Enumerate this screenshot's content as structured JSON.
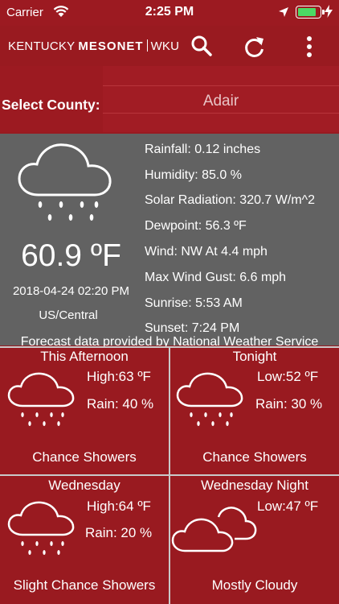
{
  "status_bar": {
    "carrier": "Carrier",
    "time": "2:25 PM",
    "icons": [
      "wifi-icon",
      "location-arrow-icon",
      "battery-icon",
      "charging-icon"
    ],
    "battery_color": "#4cd964"
  },
  "app_bar": {
    "logo_prefix": "KENTUCKY ",
    "logo_bold": "MESONET",
    "logo_suffix": "WKU",
    "actions": [
      "search-icon",
      "refresh-icon",
      "more-vertical-icon"
    ]
  },
  "county": {
    "label": "Select County:",
    "selected": "Adair"
  },
  "current": {
    "icon": "rain-cloud-icon",
    "temperature": "60.9 ºF",
    "datetime": "2018-04-24 02:20 PM",
    "timezone": "US/Central",
    "stats": [
      "Rainfall: 0.12 inches",
      "Humidity: 85.0 %",
      "Solar Radiation: 320.7 W/m^2",
      "Dewpoint: 56.3 ºF",
      "Wind: NW At 4.4 mph",
      "Max Wind Gust: 6.6 mph",
      "Sunrise: 5:53 AM",
      "Sunset: 7:24 PM"
    ]
  },
  "forecast_credit": "Forecast data provided by National Weather Service",
  "forecast": [
    {
      "period": "This Afternoon",
      "temp": "High:63 ºF",
      "rain": "Rain: 40 %",
      "summary": "Chance Showers",
      "icon": "rain-cloud-icon"
    },
    {
      "period": "Tonight",
      "temp": "Low:52 ºF",
      "rain": "Rain: 30 %",
      "summary": "Chance Showers",
      "icon": "rain-cloud-icon"
    },
    {
      "period": "Wednesday",
      "temp": "High:64 ºF",
      "rain": "Rain: 20 %",
      "summary": "Slight Chance Showers",
      "icon": "rain-cloud-icon"
    },
    {
      "period": "Wednesday Night",
      "temp": "Low:47 ºF",
      "rain": "",
      "summary": "Mostly Cloudy",
      "icon": "cloudy-icon"
    }
  ],
  "colors": {
    "brand_red": "#991a20",
    "current_bg": "#626262",
    "divider": "#c9c9c9"
  }
}
